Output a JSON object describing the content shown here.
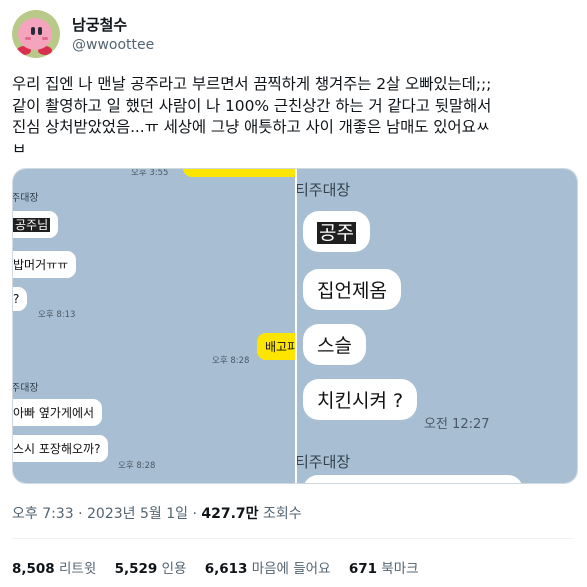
{
  "header": {
    "display_name": "남궁철수",
    "handle": "@wwoottee"
  },
  "tweet": {
    "text": "우리 집엔 나 맨날 공주라고 부르면서 끔찍하게 챙겨주는 2살 오빠있는데;;;\n같이 촬영하고 일 했던 사람이 나 100% 근친상간 하는 거 같다고 뒷말해서\n진심 상처받았었음...ㅠ 세상에 그냥 애틋하고 사이 개좋은 남매도 있어요ㅆ\nㅂ"
  },
  "media": {
    "left": {
      "top_time": "오후 3:55",
      "sender1": "주대장",
      "msg1": "공주님",
      "msg2": "밥머거ㅠㅠ",
      "msg3": "?",
      "time1": "오후 8:13",
      "my_msg": "배고파",
      "time2": "오후 8:28",
      "sender2": "주대장",
      "msg4": "아빠 옆가게에서",
      "msg5": "스시 포장해오까?",
      "time3": "오후 8:28"
    },
    "right": {
      "sender1": "티주대장",
      "msg1": "공주",
      "msg2": "집언제옴",
      "msg3": "스슬",
      "msg4": "치킨시켜 ?",
      "time1": "오전 12:27",
      "sender2": "티주대장"
    }
  },
  "meta": {
    "time": "오후 7:33",
    "sep": "·",
    "date": "2023년 5월 1일",
    "views_count": "427.7만",
    "views_label": "조회수"
  },
  "stats": {
    "retweets_count": "8,508",
    "retweets_label": "리트윗",
    "quotes_count": "5,529",
    "quotes_label": "인용",
    "likes_count": "6,613",
    "likes_label": "마음에 들어요",
    "bookmarks_count": "671",
    "bookmarks_label": "북마크"
  }
}
